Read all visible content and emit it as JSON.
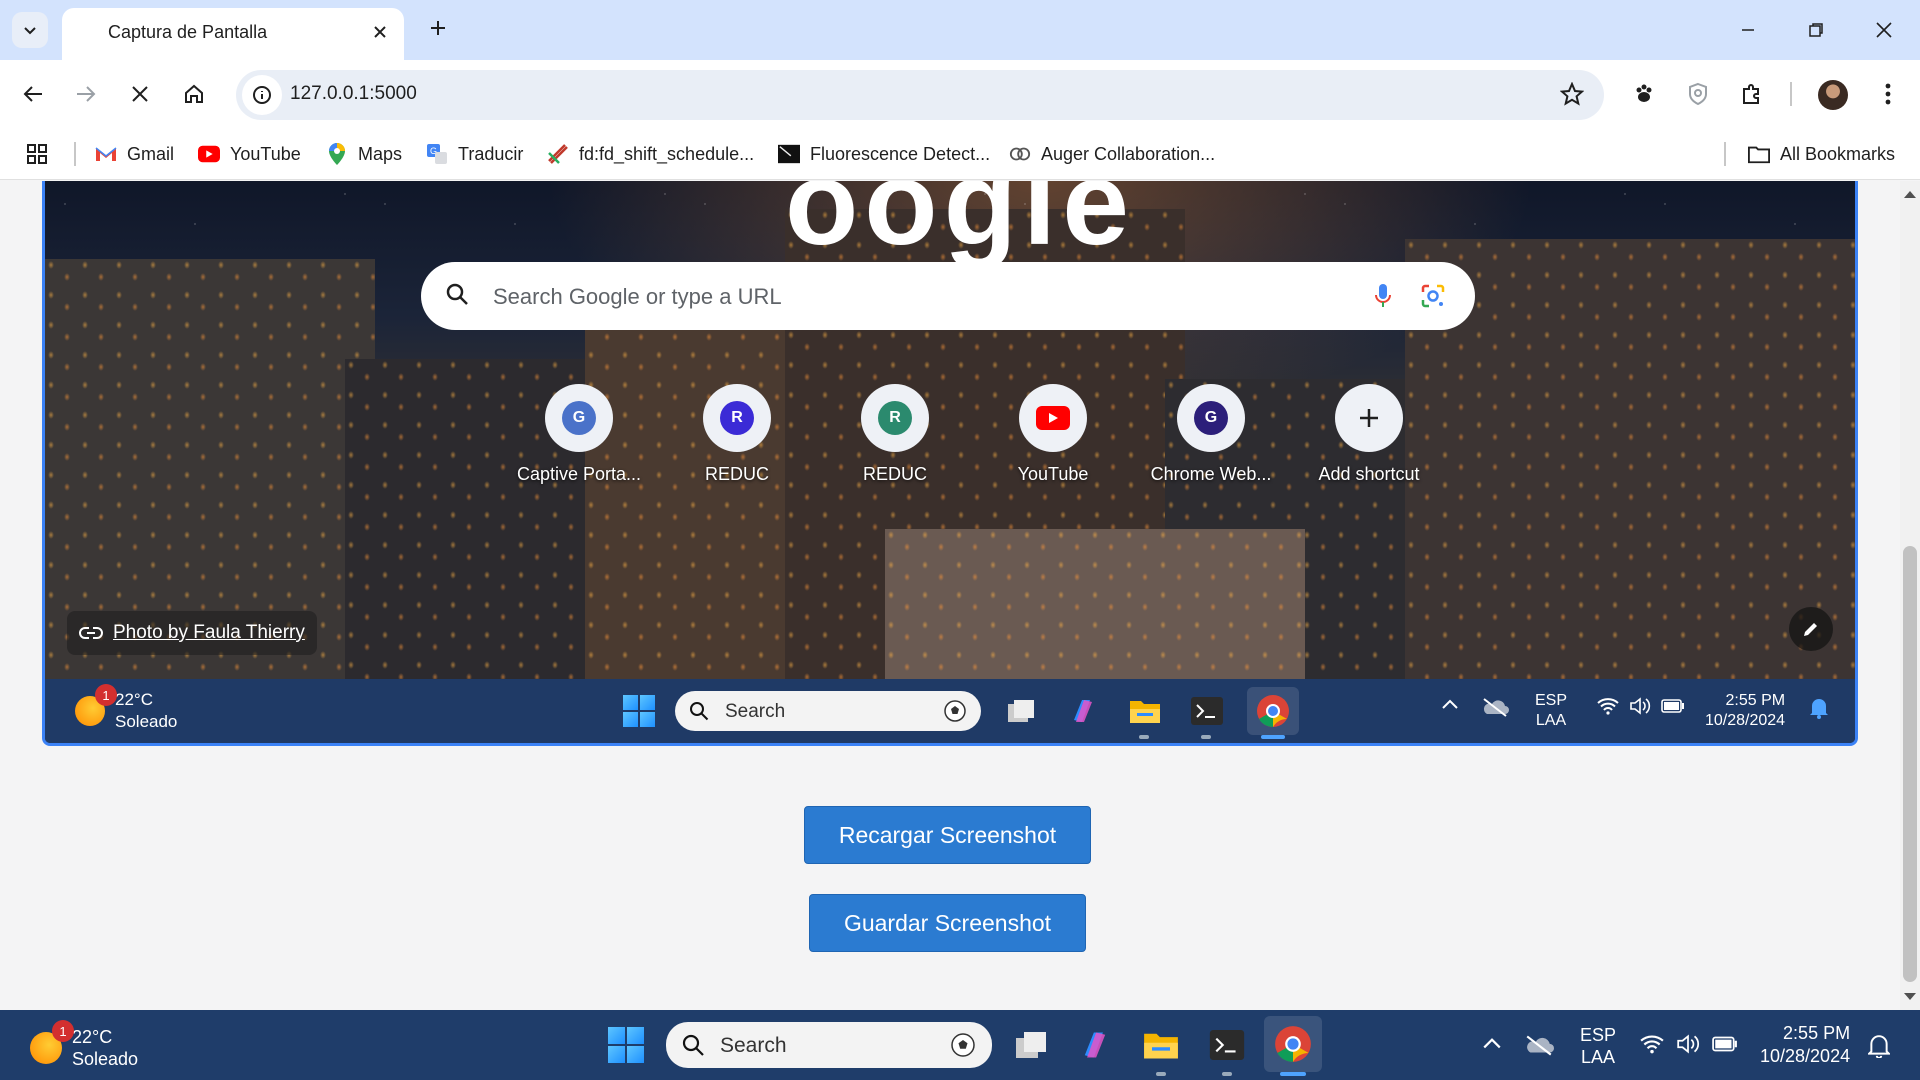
{
  "browser": {
    "tab_title": "Captura de Pantalla",
    "url": "127.0.0.1:5000",
    "bookmarks": [
      {
        "label": "Gmail",
        "icon": "gmail-icon"
      },
      {
        "label": "YouTube",
        "icon": "youtube-icon"
      },
      {
        "label": "Maps",
        "icon": "maps-icon"
      },
      {
        "label": "Traducir",
        "icon": "translate-icon"
      },
      {
        "label": "fd:fd_shift_schedule...",
        "icon": "schedule-icon"
      },
      {
        "label": "Fluorescence Detect...",
        "icon": "fluorescence-icon"
      },
      {
        "label": "Auger Collaboration...",
        "icon": "auger-icon"
      }
    ],
    "all_bookmarks": "All Bookmarks"
  },
  "screenshot": {
    "search_placeholder": "Search Google or type a URL",
    "shortcuts": [
      {
        "letter": "G",
        "label": "Captive Porta...",
        "color": "#4a72c9"
      },
      {
        "letter": "R",
        "label": "REDUC",
        "color": "#3b2bd6"
      },
      {
        "letter": "R",
        "label": "REDUC",
        "color": "#2b8a6e"
      },
      {
        "letter": "",
        "label": "YouTube",
        "color": "#ff0000"
      },
      {
        "letter": "G",
        "label": "Chrome Web...",
        "color": "#2c1f7a"
      },
      {
        "letter": "+",
        "label": "Add shortcut",
        "color": "#1f1f1f"
      }
    ],
    "photo_credit": "Photo by Faula Thierry",
    "taskbar": {
      "badge": "1",
      "temp": "22°C",
      "weather": "Soleado",
      "search": "Search",
      "lang1": "ESP",
      "lang2": "LAA",
      "time": "2:55 PM",
      "date": "10/28/2024"
    }
  },
  "actions": {
    "reload": "Recargar Screenshot",
    "save": "Guardar Screenshot"
  },
  "taskbar": {
    "badge": "1",
    "temp": "22°C",
    "weather": "Soleado",
    "search": "Search",
    "lang1": "ESP",
    "lang2": "LAA",
    "time": "2:55 PM",
    "date": "10/28/2024"
  },
  "colors": {
    "accent_blue": "#2b7bd1",
    "taskbar": "#1f3d6a",
    "tabstrip": "#d3e3fd"
  }
}
